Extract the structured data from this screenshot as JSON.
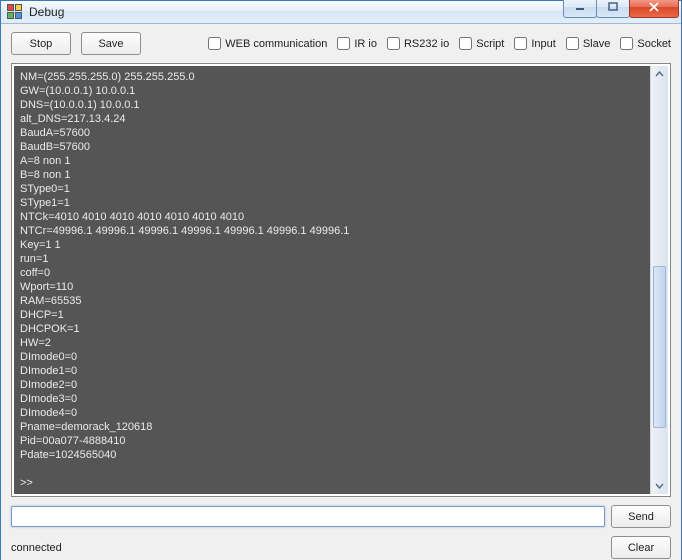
{
  "window": {
    "title": "Debug"
  },
  "buttons": {
    "stop": "Stop",
    "save": "Save",
    "send": "Send",
    "clear": "Clear"
  },
  "checkboxes": {
    "web": "WEB communication",
    "ir": "IR io",
    "rs232": "RS232 io",
    "script": "Script",
    "input": "Input",
    "slave": "Slave",
    "socket": "Socket"
  },
  "terminal": {
    "content": "NM=(255.255.255.0) 255.255.255.0\nGW=(10.0.0.1) 10.0.0.1\nDNS=(10.0.0.1) 10.0.0.1\nalt_DNS=217.13.4.24\nBaudA=57600\nBaudB=57600\nA=8 non 1\nB=8 non 1\nSType0=1\nSType1=1\nNTCk=4010 4010 4010 4010 4010 4010 4010\nNTCr=49996.1 49996.1 49996.1 49996.1 49996.1 49996.1 49996.1\nKey=1 1\nrun=1\ncoff=0\nWport=110\nRAM=65535\nDHCP=1\nDHCPOK=1\nHW=2\nDImode0=0\nDImode1=0\nDImode2=0\nDImode3=0\nDImode4=0\nPname=demorack_120618\nPid=00a077-4888410\nPdate=1024565040\n\n>>"
  },
  "command_input": {
    "value": "",
    "placeholder": ""
  },
  "status": {
    "text": "connected"
  }
}
